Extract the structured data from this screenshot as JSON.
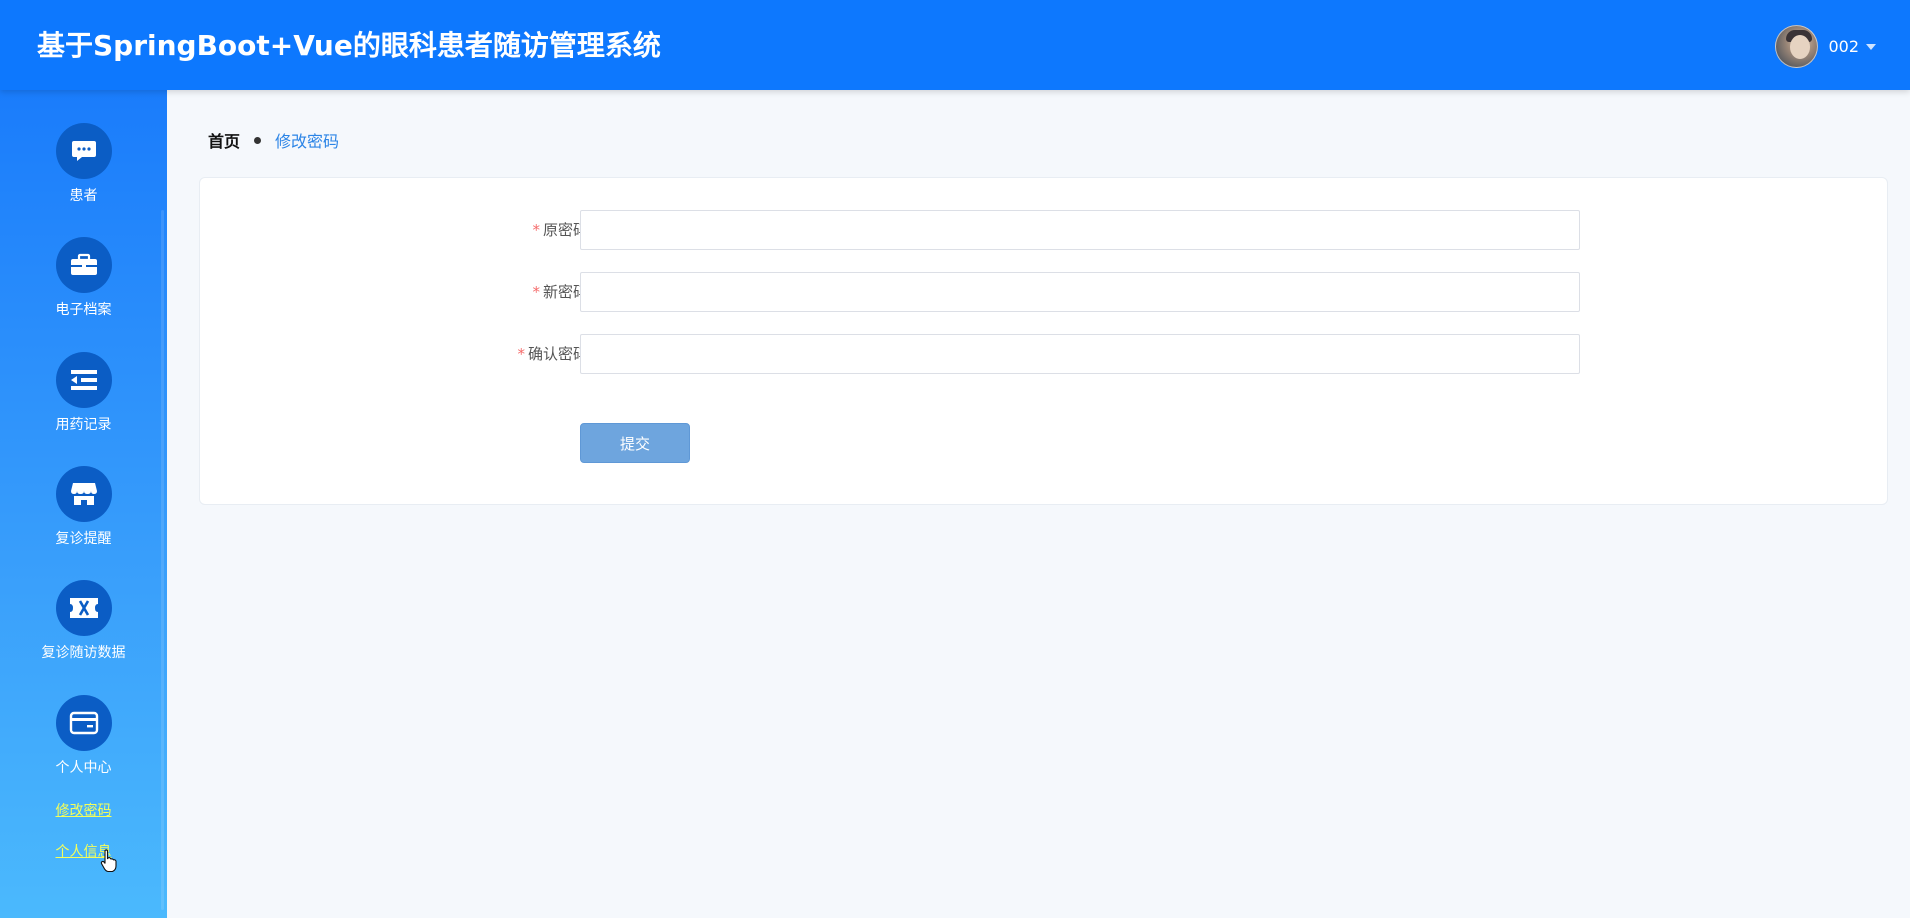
{
  "header": {
    "title": "基于SpringBoot+Vue的眼科患者随访管理系统",
    "user_name": "002"
  },
  "sidebar": {
    "items": [
      {
        "label": "患者",
        "icon": "chat-icon"
      },
      {
        "label": "电子档案",
        "icon": "briefcase-icon"
      },
      {
        "label": "用药记录",
        "icon": "list-indent-icon"
      },
      {
        "label": "复诊提醒",
        "icon": "shop-icon"
      },
      {
        "label": "复诊随访数据",
        "icon": "ticket-icon"
      },
      {
        "label": "个人中心",
        "icon": "wallet-card-icon"
      }
    ],
    "sub_links": [
      "修改密码",
      "个人信息"
    ]
  },
  "breadcrumb": {
    "home": "首页",
    "current": "修改密码"
  },
  "form": {
    "required_mark": "*",
    "fields": [
      {
        "label": "原密码",
        "value": "",
        "placeholder": ""
      },
      {
        "label": "新密码",
        "value": "",
        "placeholder": ""
      },
      {
        "label": "确认密码",
        "value": "",
        "placeholder": ""
      }
    ],
    "submit_label": "提交"
  },
  "colors": {
    "header_bg": "#0d78fe",
    "sidebar_top": "#1a7cfb",
    "sidebar_bottom": "#4bb9fd",
    "icon_circle": "#0b5dc5",
    "sub_link": "#f4ff5a",
    "submit_bg": "#6ea5de",
    "required": "#f56c6c"
  }
}
